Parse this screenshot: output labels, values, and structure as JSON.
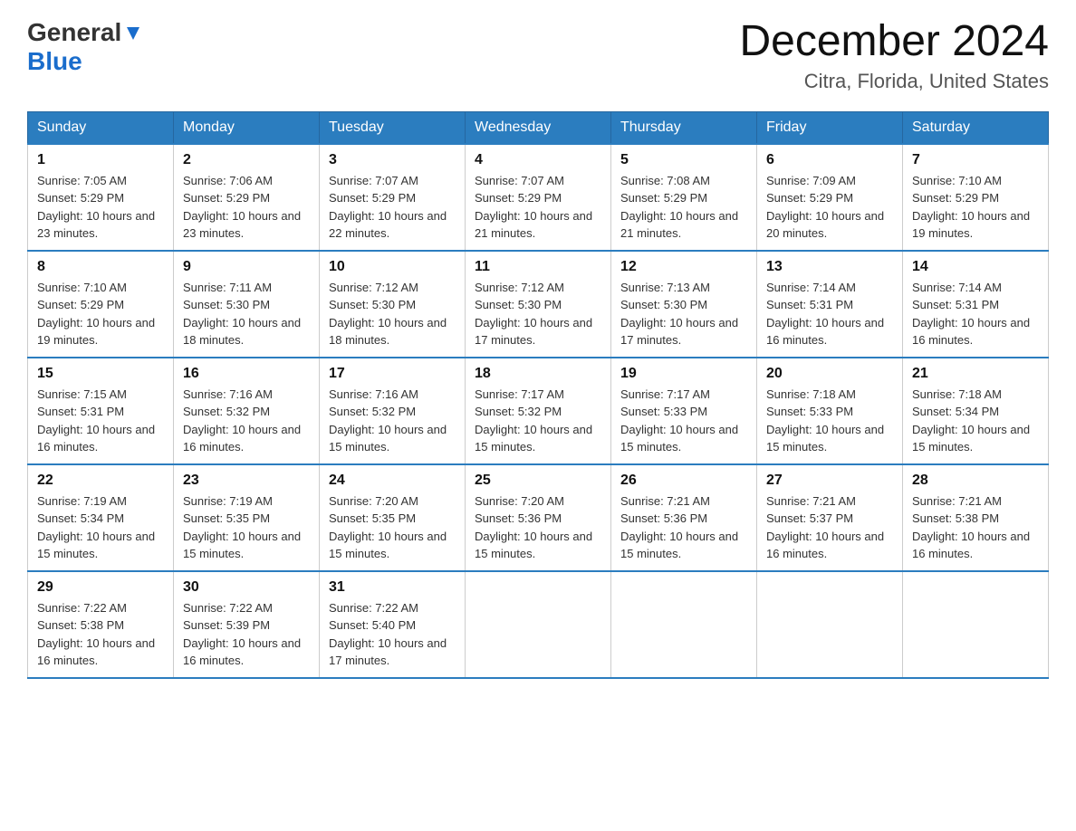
{
  "header": {
    "logo_general": "General",
    "logo_blue": "Blue",
    "month_title": "December 2024",
    "location": "Citra, Florida, United States"
  },
  "days_of_week": [
    "Sunday",
    "Monday",
    "Tuesday",
    "Wednesday",
    "Thursday",
    "Friday",
    "Saturday"
  ],
  "weeks": [
    [
      {
        "day": "1",
        "sunrise": "7:05 AM",
        "sunset": "5:29 PM",
        "daylight": "10 hours and 23 minutes."
      },
      {
        "day": "2",
        "sunrise": "7:06 AM",
        "sunset": "5:29 PM",
        "daylight": "10 hours and 23 minutes."
      },
      {
        "day": "3",
        "sunrise": "7:07 AM",
        "sunset": "5:29 PM",
        "daylight": "10 hours and 22 minutes."
      },
      {
        "day": "4",
        "sunrise": "7:07 AM",
        "sunset": "5:29 PM",
        "daylight": "10 hours and 21 minutes."
      },
      {
        "day": "5",
        "sunrise": "7:08 AM",
        "sunset": "5:29 PM",
        "daylight": "10 hours and 21 minutes."
      },
      {
        "day": "6",
        "sunrise": "7:09 AM",
        "sunset": "5:29 PM",
        "daylight": "10 hours and 20 minutes."
      },
      {
        "day": "7",
        "sunrise": "7:10 AM",
        "sunset": "5:29 PM",
        "daylight": "10 hours and 19 minutes."
      }
    ],
    [
      {
        "day": "8",
        "sunrise": "7:10 AM",
        "sunset": "5:29 PM",
        "daylight": "10 hours and 19 minutes."
      },
      {
        "day": "9",
        "sunrise": "7:11 AM",
        "sunset": "5:30 PM",
        "daylight": "10 hours and 18 minutes."
      },
      {
        "day": "10",
        "sunrise": "7:12 AM",
        "sunset": "5:30 PM",
        "daylight": "10 hours and 18 minutes."
      },
      {
        "day": "11",
        "sunrise": "7:12 AM",
        "sunset": "5:30 PM",
        "daylight": "10 hours and 17 minutes."
      },
      {
        "day": "12",
        "sunrise": "7:13 AM",
        "sunset": "5:30 PM",
        "daylight": "10 hours and 17 minutes."
      },
      {
        "day": "13",
        "sunrise": "7:14 AM",
        "sunset": "5:31 PM",
        "daylight": "10 hours and 16 minutes."
      },
      {
        "day": "14",
        "sunrise": "7:14 AM",
        "sunset": "5:31 PM",
        "daylight": "10 hours and 16 minutes."
      }
    ],
    [
      {
        "day": "15",
        "sunrise": "7:15 AM",
        "sunset": "5:31 PM",
        "daylight": "10 hours and 16 minutes."
      },
      {
        "day": "16",
        "sunrise": "7:16 AM",
        "sunset": "5:32 PM",
        "daylight": "10 hours and 16 minutes."
      },
      {
        "day": "17",
        "sunrise": "7:16 AM",
        "sunset": "5:32 PM",
        "daylight": "10 hours and 15 minutes."
      },
      {
        "day": "18",
        "sunrise": "7:17 AM",
        "sunset": "5:32 PM",
        "daylight": "10 hours and 15 minutes."
      },
      {
        "day": "19",
        "sunrise": "7:17 AM",
        "sunset": "5:33 PM",
        "daylight": "10 hours and 15 minutes."
      },
      {
        "day": "20",
        "sunrise": "7:18 AM",
        "sunset": "5:33 PM",
        "daylight": "10 hours and 15 minutes."
      },
      {
        "day": "21",
        "sunrise": "7:18 AM",
        "sunset": "5:34 PM",
        "daylight": "10 hours and 15 minutes."
      }
    ],
    [
      {
        "day": "22",
        "sunrise": "7:19 AM",
        "sunset": "5:34 PM",
        "daylight": "10 hours and 15 minutes."
      },
      {
        "day": "23",
        "sunrise": "7:19 AM",
        "sunset": "5:35 PM",
        "daylight": "10 hours and 15 minutes."
      },
      {
        "day": "24",
        "sunrise": "7:20 AM",
        "sunset": "5:35 PM",
        "daylight": "10 hours and 15 minutes."
      },
      {
        "day": "25",
        "sunrise": "7:20 AM",
        "sunset": "5:36 PM",
        "daylight": "10 hours and 15 minutes."
      },
      {
        "day": "26",
        "sunrise": "7:21 AM",
        "sunset": "5:36 PM",
        "daylight": "10 hours and 15 minutes."
      },
      {
        "day": "27",
        "sunrise": "7:21 AM",
        "sunset": "5:37 PM",
        "daylight": "10 hours and 16 minutes."
      },
      {
        "day": "28",
        "sunrise": "7:21 AM",
        "sunset": "5:38 PM",
        "daylight": "10 hours and 16 minutes."
      }
    ],
    [
      {
        "day": "29",
        "sunrise": "7:22 AM",
        "sunset": "5:38 PM",
        "daylight": "10 hours and 16 minutes."
      },
      {
        "day": "30",
        "sunrise": "7:22 AM",
        "sunset": "5:39 PM",
        "daylight": "10 hours and 16 minutes."
      },
      {
        "day": "31",
        "sunrise": "7:22 AM",
        "sunset": "5:40 PM",
        "daylight": "10 hours and 17 minutes."
      },
      null,
      null,
      null,
      null
    ]
  ],
  "sunrise_label": "Sunrise:",
  "sunset_label": "Sunset:",
  "daylight_label": "Daylight:"
}
